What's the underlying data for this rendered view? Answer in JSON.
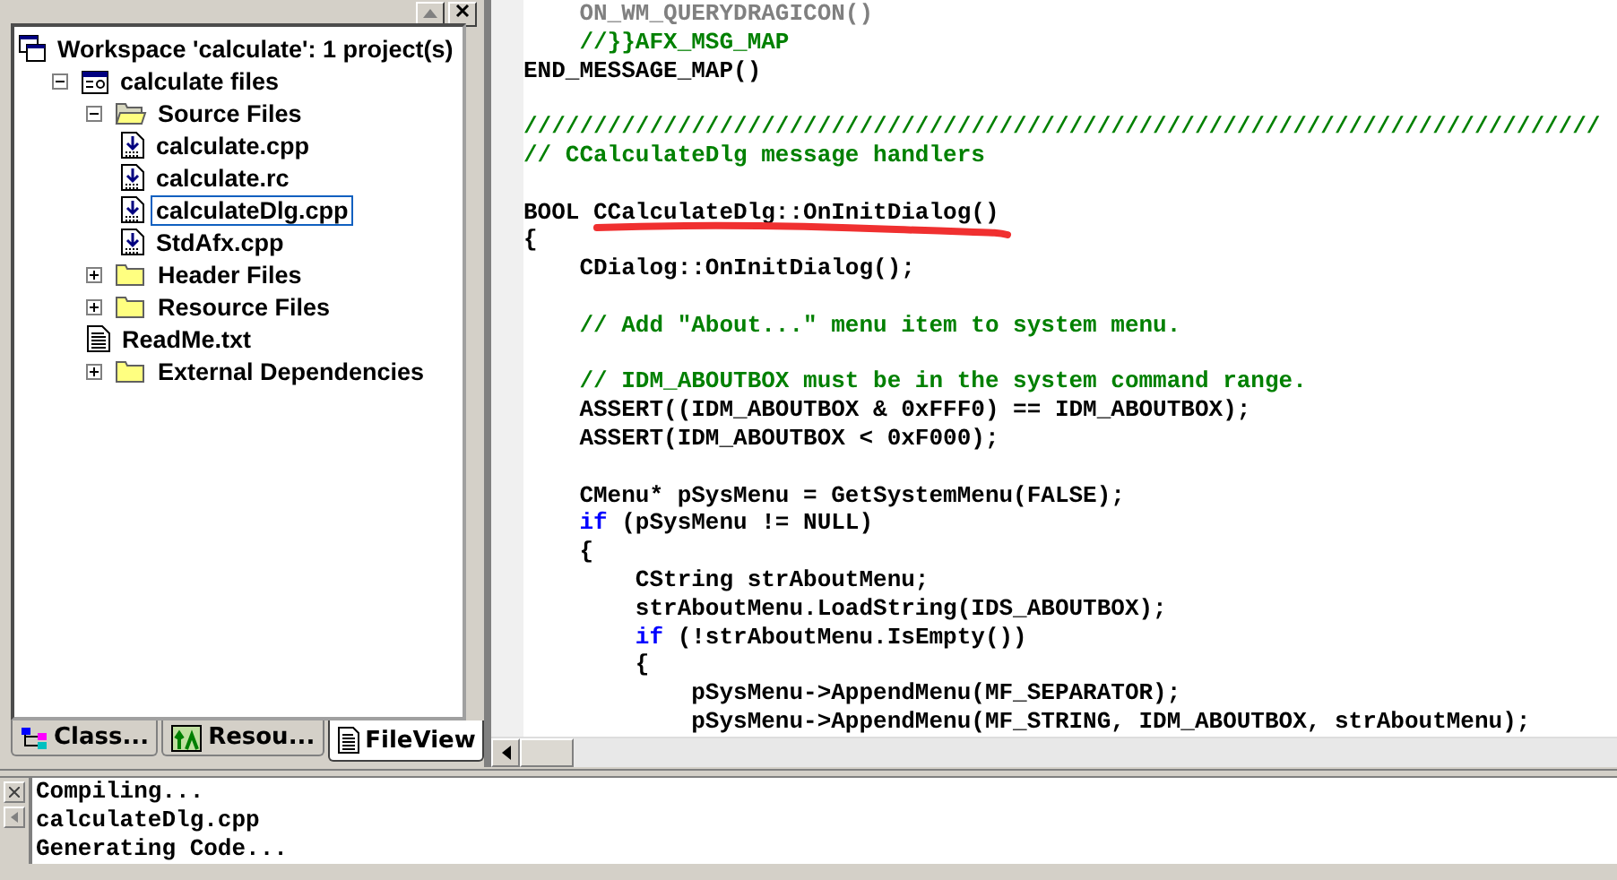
{
  "workspace": {
    "tree": [
      {
        "label": "Workspace 'calculate': 1 project(s)",
        "kind": "workspace",
        "selected": false,
        "children": [
          {
            "label": "calculate files",
            "kind": "project",
            "expanded": true,
            "selected": false,
            "children": [
              {
                "label": "Source Files",
                "kind": "folder-open",
                "expanded": true,
                "selected": false,
                "children": [
                  {
                    "label": "calculate.cpp",
                    "kind": "source",
                    "selected": false
                  },
                  {
                    "label": "calculate.rc",
                    "kind": "source",
                    "selected": false
                  },
                  {
                    "label": "calculateDlg.cpp",
                    "kind": "source",
                    "selected": true
                  },
                  {
                    "label": "StdAfx.cpp",
                    "kind": "source",
                    "selected": false
                  }
                ]
              },
              {
                "label": "Header Files",
                "kind": "folder",
                "expanded": false,
                "selected": false
              },
              {
                "label": "Resource Files",
                "kind": "folder",
                "expanded": false,
                "selected": false
              },
              {
                "label": "ReadMe.txt",
                "kind": "text",
                "selected": false
              },
              {
                "label": "External Dependencies",
                "kind": "folder",
                "expanded": false,
                "selected": false
              }
            ]
          }
        ]
      }
    ],
    "tabs": [
      {
        "label": "Class...",
        "kind": "class",
        "selected": false
      },
      {
        "label": "Resou...",
        "kind": "resource",
        "selected": false
      },
      {
        "label": "FileView",
        "kind": "file",
        "selected": true
      }
    ]
  },
  "editor": {
    "blocks": [
      [
        [
          {
            "kind": "inactive",
            "text": "    ON_WM_QUERYDRAGICON()"
          }
        ],
        [
          {
            "kind": "comment",
            "text": "    //}}AFX_MSG_MAP"
          }
        ],
        [
          {
            "kind": "plain",
            "text": "END_MESSAGE_MAP()"
          }
        ]
      ],
      [
        [
          {
            "kind": "comment",
            "text": "/////////////////////////////////////////////////////////////////////////////"
          }
        ],
        [
          {
            "kind": "comment",
            "text": "// CCalculateDlg message handlers"
          }
        ]
      ],
      [
        [
          {
            "kind": "plain",
            "text": "BOOL CCalculateDlg::OnInitDialog()",
            "annotated": true
          }
        ],
        [
          {
            "kind": "plain",
            "text": "{"
          }
        ],
        [
          {
            "kind": "plain",
            "text": "    CDialog::OnInitDialog();"
          }
        ]
      ],
      [
        [
          {
            "kind": "comment",
            "text": "    // Add \"About...\" menu item to system menu."
          }
        ]
      ],
      [
        [
          {
            "kind": "comment",
            "text": "    // IDM_ABOUTBOX must be in the system command range."
          }
        ],
        [
          {
            "kind": "plain",
            "text": "    ASSERT((IDM_ABOUTBOX & 0xFFF0) == IDM_ABOUTBOX);"
          }
        ],
        [
          {
            "kind": "plain",
            "text": "    ASSERT(IDM_ABOUTBOX < 0xF000);"
          }
        ]
      ],
      [
        [
          {
            "kind": "plain",
            "text": "    CMenu* pSysMenu = GetSystemMenu(FALSE);"
          }
        ],
        [
          {
            "kind": "keyword",
            "text": "    if"
          },
          {
            "kind": "plain",
            "text": " (pSysMenu != NULL)"
          }
        ],
        [
          {
            "kind": "plain",
            "text": "    {"
          }
        ],
        [
          {
            "kind": "plain",
            "text": "        CString strAboutMenu;"
          }
        ],
        [
          {
            "kind": "plain",
            "text": "        strAboutMenu.LoadString(IDS_ABOUTBOX);"
          }
        ],
        [
          {
            "kind": "keyword",
            "text": "        if"
          },
          {
            "kind": "plain",
            "text": " (!strAboutMenu.IsEmpty())"
          }
        ],
        [
          {
            "kind": "plain",
            "text": "        {"
          }
        ],
        [
          {
            "kind": "plain",
            "text": "            pSysMenu->AppendMenu(MF_SEPARATOR);"
          }
        ],
        [
          {
            "kind": "plain",
            "text": "            pSysMenu->AppendMenu(MF_STRING, IDM_ABOUTBOX, strAboutMenu);"
          }
        ]
      ]
    ]
  },
  "output": {
    "lines": [
      "Compiling...",
      "calculateDlg.cpp",
      "Generating Code..."
    ]
  }
}
